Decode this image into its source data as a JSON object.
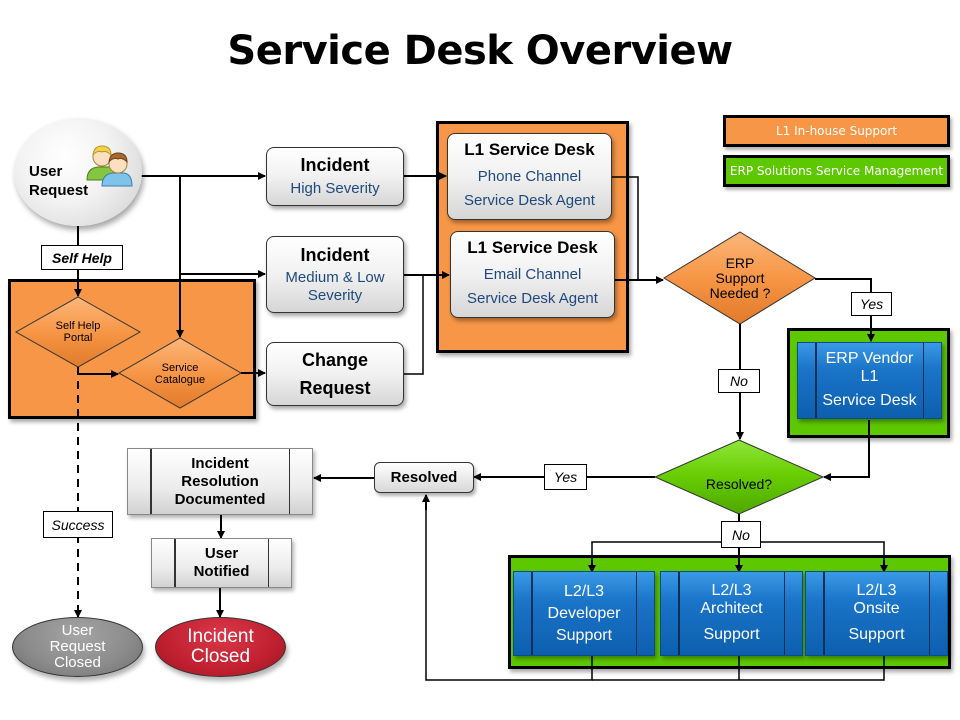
{
  "title": "Service Desk Overview",
  "legend": {
    "l1_inhouse": "L1 In-house Support",
    "erp_solutions": "ERP Solutions Service Management"
  },
  "colors": {
    "orange": "#f79646",
    "green": "#5dc800",
    "blue": "#1a74c8",
    "red": "#c0202f",
    "grey": "#8a8a8a",
    "subtext_blue": "#1f497d"
  },
  "nodes": {
    "user_request": {
      "line1": "User",
      "line2": "Request",
      "icon": "users-icon"
    },
    "self_help_label": "Self Help",
    "self_help_portal": {
      "line1": "Self Help",
      "line2": "Portal"
    },
    "service_catalogue": {
      "line1": "Service",
      "line2": "Catalogue"
    },
    "incident_high": {
      "title": "Incident",
      "sub": "High Severity"
    },
    "incident_medlow": {
      "title": "Incident",
      "sub1": "Medium & Low",
      "sub2": "Severity"
    },
    "change_request": {
      "line1": "Change",
      "line2": "Request"
    },
    "l1_phone": {
      "title": "L1 Service Desk",
      "sub1": "Phone Channel",
      "sub2": "Service Desk Agent"
    },
    "l1_email": {
      "title": "L1 Service Desk",
      "sub1": "Email Channel",
      "sub2": "Service Desk Agent"
    },
    "erp_support_needed": {
      "line1": "ERP",
      "line2": "Support",
      "line3": "Needed ?"
    },
    "erp_vendor": {
      "line1": "ERP Vendor",
      "line2": "L1",
      "line3": "Service Desk"
    },
    "resolved_decision": "Resolved?",
    "resolved_box": "Resolved",
    "incident_resolution": {
      "line1": "Incident",
      "line2": "Resolution",
      "line3": "Documented"
    },
    "user_notified": {
      "line1": "User",
      "line2": "Notified"
    },
    "user_request_closed": {
      "line1": "User",
      "line2": "Request",
      "line3": "Closed"
    },
    "incident_closed": {
      "line1": "Incident",
      "line2": "Closed"
    },
    "l2_developer": {
      "line1": "L2/L3",
      "line2": "Developer",
      "line3": "Support"
    },
    "l2_architect": {
      "line1": "L2/L3",
      "line2": "Architect",
      "line3": "Support"
    },
    "l2_onsite": {
      "line1": "L2/L3",
      "line2": "Onsite",
      "line3": "Support"
    }
  },
  "edge_labels": {
    "yes_erp": "Yes",
    "no_erp": "No",
    "yes_resolved": "Yes",
    "no_resolved": "No",
    "success": "Success"
  }
}
